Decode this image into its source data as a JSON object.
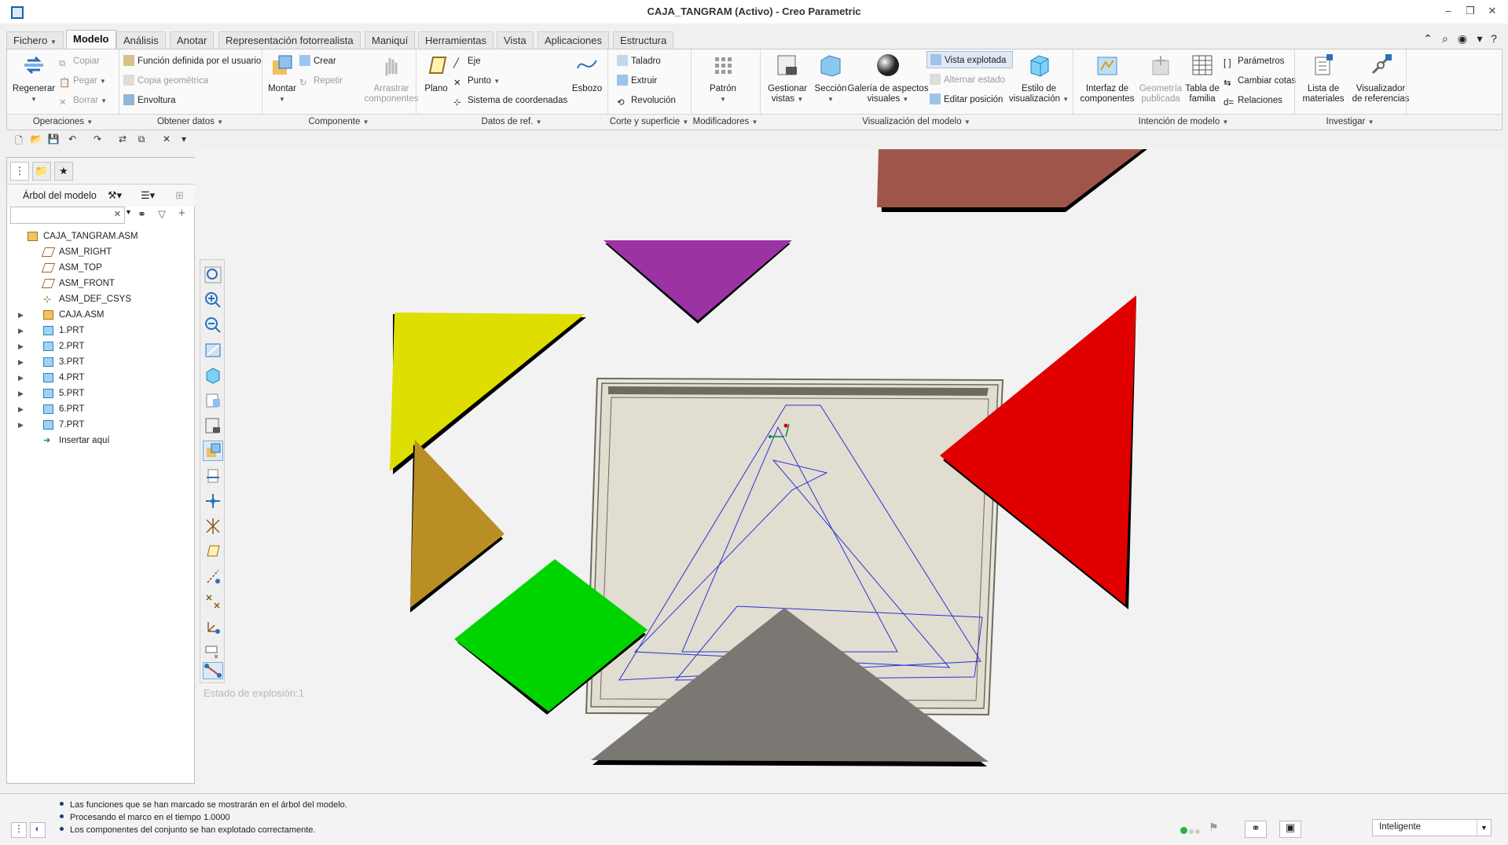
{
  "window": {
    "title": "CAJA_TANGRAM (Activo) - Creo Parametric"
  },
  "tabs": [
    "Fichero",
    "Modelo",
    "Análisis",
    "Anotar",
    "Representación fotorrealista",
    "Maniquí",
    "Herramientas",
    "Vista",
    "Aplicaciones",
    "Estructura"
  ],
  "ribbon": {
    "regenerar": "Regenerar",
    "copiar": "Copiar",
    "pegar": "Pegar",
    "borrar": "Borrar",
    "udf": "Función definida por el usuario",
    "copia_geom": "Copia geométrica",
    "envoltura": "Envoltura",
    "montar": "Montar",
    "crear": "Crear",
    "repetir": "Repetir",
    "arrastrar1": "Arrastrar",
    "arrastrar2": "componentes",
    "plano": "Plano",
    "eje": "Eje",
    "punto": "Punto",
    "sistema": "Sistema de coordenadas",
    "esbozo": "Esbozo",
    "taladro": "Taladro",
    "extruir": "Extruir",
    "revolucion": "Revolución",
    "patron": "Patrón",
    "gestionar1": "Gestionar",
    "gestionar2": "vistas",
    "seccion": "Sección",
    "galeria1": "Galería de aspectos",
    "galeria2": "visuales",
    "vista_explotada": "Vista explotada",
    "alternar_estado": "Alternar estado",
    "editar_posicion": "Editar posición",
    "estilo1": "Estilo de",
    "estilo2": "visualización",
    "interfaz1": "Interfaz de",
    "interfaz2": "componentes",
    "geometria1": "Geometría",
    "geometria2": "publicada",
    "tabla1": "Tabla de",
    "tabla2": "familia",
    "parametros": "Parámetros",
    "cambiar_cotas": "Cambiar cotas",
    "relaciones": "Relaciones",
    "lista1": "Lista de",
    "lista2": "materiales",
    "visualizador1": "Visualizador",
    "visualizador2": "de referencias"
  },
  "groups": [
    "Operaciones",
    "Obtener datos",
    "Componente",
    "Datos de ref.",
    "Corte y superficie",
    "Modificadores",
    "Visualización del modelo",
    "Intención de modelo",
    "Investigar"
  ],
  "model_tree": {
    "title": "Árbol del modelo",
    "items": [
      {
        "label": "CAJA_TANGRAM.ASM",
        "icon": "assembly-icon",
        "level": 0,
        "expandable": false
      },
      {
        "label": "ASM_RIGHT",
        "icon": "datum-plane-icon",
        "level": 1,
        "expandable": false
      },
      {
        "label": "ASM_TOP",
        "icon": "datum-plane-icon",
        "level": 1,
        "expandable": false
      },
      {
        "label": "ASM_FRONT",
        "icon": "datum-plane-icon",
        "level": 1,
        "expandable": false
      },
      {
        "label": "ASM_DEF_CSYS",
        "icon": "csys-icon",
        "level": 1,
        "expandable": false
      },
      {
        "label": "CAJA.ASM",
        "icon": "assembly-icon",
        "level": 1,
        "expandable": true
      },
      {
        "label": "1.PRT",
        "icon": "part-icon",
        "level": 1,
        "expandable": true
      },
      {
        "label": "2.PRT",
        "icon": "part-icon",
        "level": 1,
        "expandable": true
      },
      {
        "label": "3.PRT",
        "icon": "part-icon",
        "level": 1,
        "expandable": true
      },
      {
        "label": "4.PRT",
        "icon": "part-icon",
        "level": 1,
        "expandable": true
      },
      {
        "label": "5.PRT",
        "icon": "part-icon",
        "level": 1,
        "expandable": true
      },
      {
        "label": "6.PRT",
        "icon": "part-icon",
        "level": 1,
        "expandable": true
      },
      {
        "label": "7.PRT",
        "icon": "part-icon",
        "level": 1,
        "expandable": true
      },
      {
        "label": "Insertar aquí",
        "icon": "insert-arrow-icon",
        "level": 1,
        "expandable": false
      }
    ]
  },
  "graphics": {
    "explode_state": "Estado de explosión:1",
    "piece_colors": {
      "brown_square": "#a0554a",
      "purple_triangle": "#9b33a4",
      "yellow_triangle": "#dede00",
      "red_triangle": "#e00000",
      "ochre_triangle": "#b98f25",
      "green_square": "#00d400",
      "gray_triangle": "#7b7773",
      "box": "#e1ddd0",
      "sketch_lines": "#2a34d8"
    }
  },
  "status": {
    "messages": [
      "Las funciones que se han marcado se mostrarán en el árbol del modelo.",
      "Procesando el marco en el tiempo 1.0000",
      "Los componentes del conjunto se han explotado correctamente."
    ],
    "selection_filter": "Inteligente"
  }
}
